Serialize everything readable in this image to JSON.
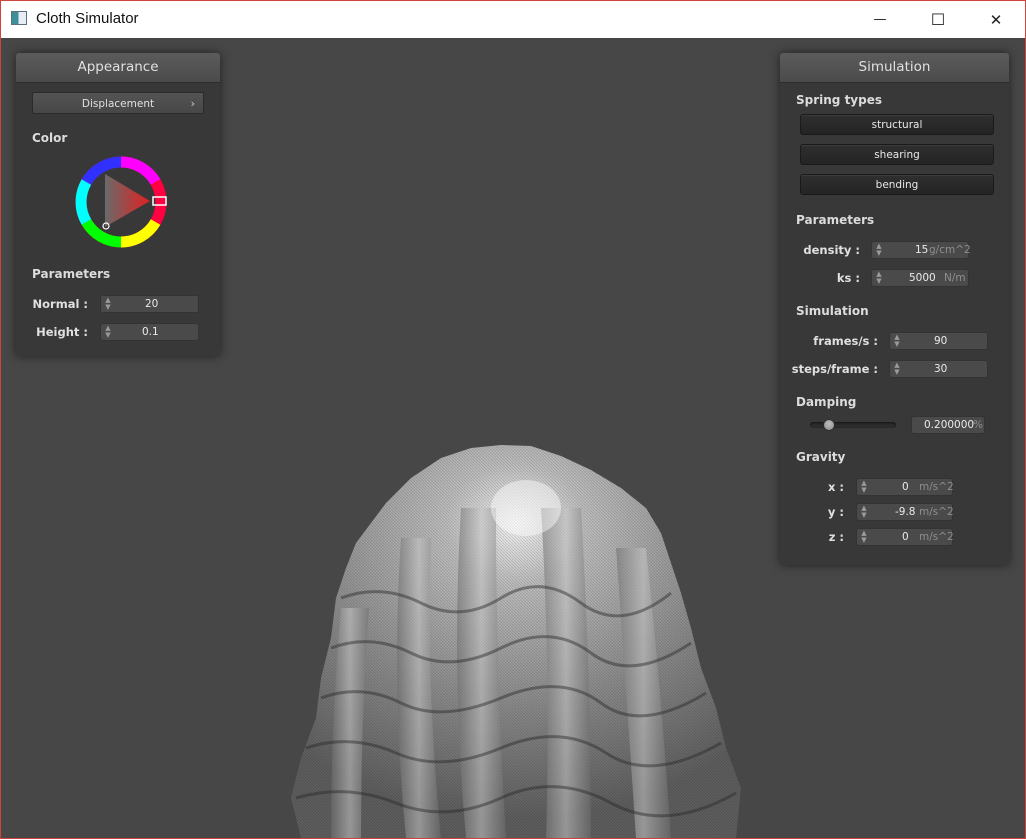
{
  "window": {
    "title": "Cloth Simulator",
    "minimize_glyph": "—",
    "maximize_glyph": "☐",
    "close_glyph": "✕"
  },
  "appearance": {
    "title": "Appearance",
    "shader_select": "Displacement",
    "color_label": "Color",
    "color_value": "#d43a3a",
    "parameters_label": "Parameters",
    "params": [
      {
        "label": "Normal :",
        "value": "20"
      },
      {
        "label": "Height :",
        "value": "0.1"
      }
    ]
  },
  "simulation": {
    "title": "Simulation",
    "spring_types_label": "Spring types",
    "spring_types": [
      "structural",
      "shearing",
      "bending"
    ],
    "parameters_label": "Parameters",
    "params": [
      {
        "label": "density :",
        "value": "15",
        "unit": "g/cm^2"
      },
      {
        "label": "ks :",
        "value": "5000",
        "unit": "N/m"
      }
    ],
    "simulation_label": "Simulation",
    "sim_params": [
      {
        "label": "frames/s :",
        "value": "90"
      },
      {
        "label": "steps/frame :",
        "value": "30"
      }
    ],
    "damping_label": "Damping",
    "damping_value": "0.200000",
    "damping_unit": "%",
    "damping_fraction": 0.2,
    "gravity_label": "Gravity",
    "gravity": [
      {
        "label": "x :",
        "value": "0",
        "unit": "m/s^2"
      },
      {
        "label": "y :",
        "value": "-9.8",
        "unit": "m/s^2"
      },
      {
        "label": "z :",
        "value": "0",
        "unit": "m/s^2"
      }
    ]
  },
  "viewport": {
    "background": "#474747",
    "cloth_color": "#b5b5b5"
  }
}
